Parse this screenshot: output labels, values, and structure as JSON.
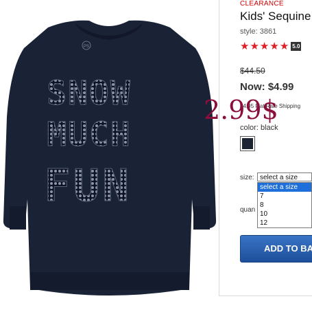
{
  "product": {
    "badge": "CLEARANCE",
    "title": "Kids' Sequine",
    "style": "style: 3861",
    "rating": "5.0",
    "star_count": 5,
    "old_price": "$44.50",
    "now_price": "Now: $4.99",
    "overlay_price": "2.99$",
    "shipping_note": "$4.95 Flat Rate Shipping",
    "shirt_text": [
      "SNOW",
      "MUCH",
      "FUN"
    ],
    "logo_text": "PS"
  },
  "color": {
    "label": "color: black",
    "swatch_hex": "#1c2333"
  },
  "size": {
    "label": "size:",
    "selected": "select a size",
    "options": [
      "select a size",
      "7",
      "8",
      "10",
      "12"
    ]
  },
  "quantity": {
    "label": "quan"
  },
  "cart": {
    "button_label": "ADD TO BA"
  },
  "colors": {
    "accent_red": "#dd1f26",
    "button_blue": "#2a5fae",
    "overlay_text": "#8a0f3c",
    "shirt_navy": "#1a2236"
  }
}
